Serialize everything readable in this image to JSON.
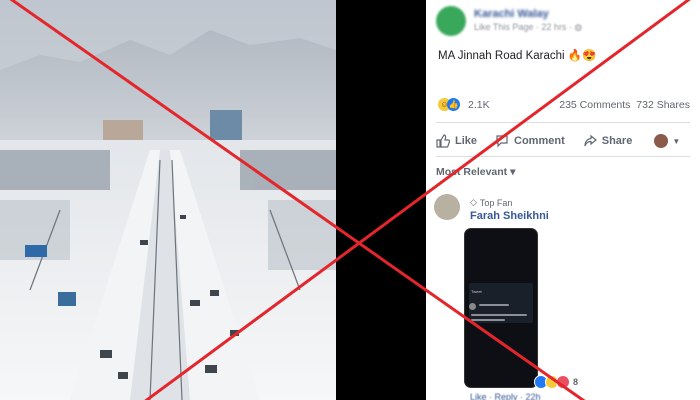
{
  "post": {
    "page_name": "Karachi Walay",
    "meta": "Like This Page · 22 hrs ·",
    "text": "MA Jinnah Road Karachi 🔥😍"
  },
  "stats": {
    "reactions": "2.1K",
    "comments": "235 Comments",
    "shares": "732 Shares"
  },
  "actions": {
    "like": "Like",
    "comment": "Comment",
    "share": "Share"
  },
  "sort": "Most Relevant ▾",
  "comment": {
    "badge": "Top Fan",
    "author": "Farah Sheikhni",
    "tweet_header": "Tweet",
    "reaction_count": "8",
    "footer": "Like · Reply · 22h"
  },
  "colors": {
    "cross": "#e3262b",
    "link": "#385898",
    "like_blue": "#2078f4"
  }
}
